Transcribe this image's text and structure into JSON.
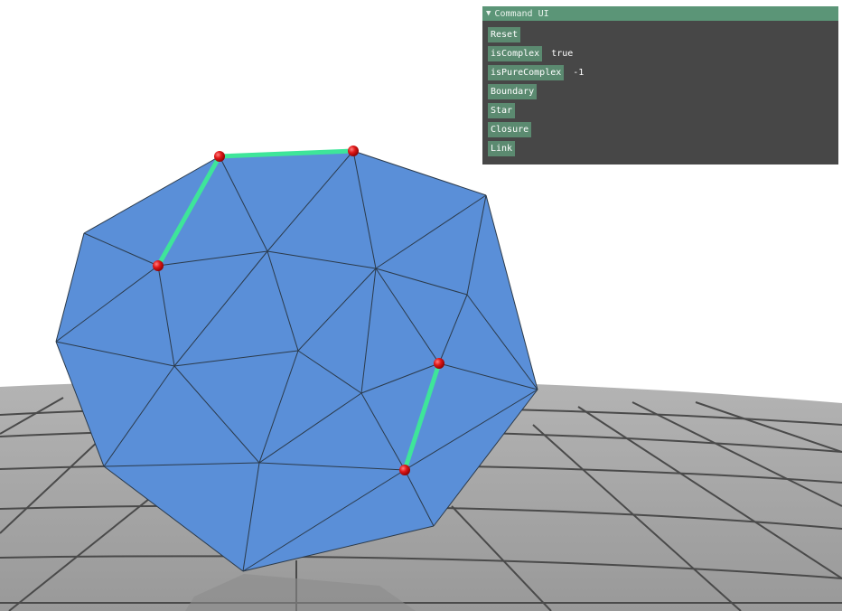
{
  "panel": {
    "title": "Command UI",
    "collapse_icon": "triangle-down-icon",
    "buttons": {
      "reset": "Reset",
      "is_complex": "isComplex",
      "is_pure_complex": "isPureComplex",
      "boundary": "Boundary",
      "star": "Star",
      "closure": "Closure",
      "link": "Link"
    },
    "values": {
      "is_complex": "true",
      "is_pure_complex": "-1"
    }
  },
  "colors": {
    "mesh_fill": "#5a8fd8",
    "mesh_edge": "#2b3a4a",
    "selected_edge": "#3ee59a",
    "selected_vertex": "#dd1111",
    "panel_bg": "#474747",
    "panel_header": "#5b9577",
    "button": "#5b8a70"
  }
}
